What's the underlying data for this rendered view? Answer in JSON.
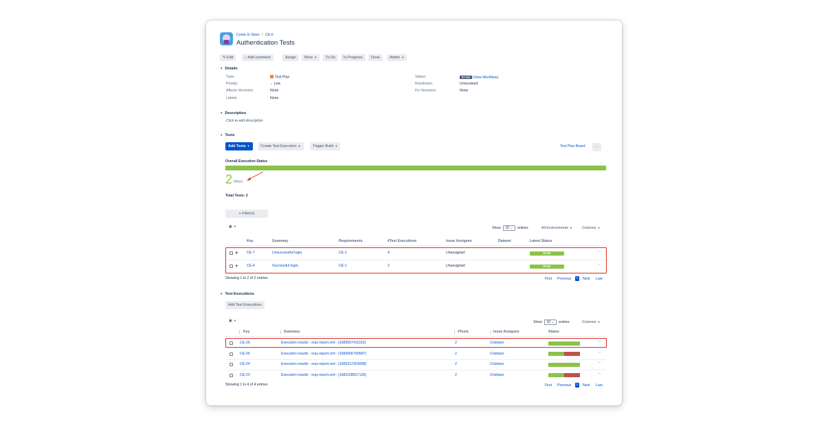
{
  "breadcrumb": {
    "project": "Comic E-Store",
    "separator": "/",
    "issue_key": "CE-6"
  },
  "issue": {
    "title": "Authentication Tests"
  },
  "toolbar": {
    "edit": "Edit",
    "add_comment": "Add comment",
    "assign": "Assign",
    "more": "More",
    "to_do": "To Do",
    "in_progress": "In Progress",
    "done": "Done",
    "admin": "Admin"
  },
  "details": {
    "heading": "Details",
    "type_label": "Type:",
    "type_value": "Test Plan",
    "priority_label": "Priority:",
    "priority_value": "Low",
    "affects_label": "Affects Version/s:",
    "affects_value": "None",
    "labels_label": "Labels:",
    "labels_value": "None",
    "status_label": "Status:",
    "status_value": "TO DO",
    "status_link": "(View Workflow)",
    "resolution_label": "Resolution:",
    "resolution_value": "Unresolved",
    "fix_label": "Fix Version/s:",
    "fix_value": "None",
    "status_badge_color": "#42526e"
  },
  "description": {
    "heading": "Description",
    "placeholder": "Click to add description"
  },
  "tests": {
    "heading": "Tests",
    "add_tests": "Add Tests",
    "create_test_execution": "Create Test Execution",
    "trigger_build": "Trigger Build",
    "test_plan_board": "Test Plan Board",
    "more_dots": "···",
    "overall_label": "Overall Execution Status",
    "overall_progress_pass_fraction": 1.0,
    "pass_count": "2",
    "pass_word": "PASS",
    "total_tests": "Total Tests: 2",
    "filter": "Filter(s)",
    "show": "Show",
    "entries_value": "10",
    "entries": "entries",
    "environments": "All Environments",
    "columns": "Columns",
    "headers": [
      "Key",
      "Summary",
      "Requirements",
      "#Test Executions",
      "Issue Assignee",
      "Dataset",
      "Latest Status"
    ],
    "rows": [
      {
        "key": "CE-7",
        "summary": "Unsuccessful login.",
        "requirement": "CE-1",
        "executions": "4",
        "assignee": "Unassigned",
        "dataset": "",
        "status": "PASS"
      },
      {
        "key": "CE-4",
        "summary": "Successful login.",
        "requirement": "CE-1",
        "executions": "2",
        "assignee": "Unassigned",
        "dataset": "",
        "status": "PASS"
      }
    ],
    "showing": "Showing 1 to 2 of 2 entries",
    "pager": {
      "first": "First",
      "previous": "Previous",
      "current": "1",
      "next": "Next",
      "last": "Last"
    },
    "pass_color": "#8bc34a"
  },
  "test_executions": {
    "heading": "Test Executions",
    "add_button": "Add Test Executions",
    "show": "Show",
    "entries_value": "10",
    "entries": "entries",
    "columns": "Columns",
    "headers": [
      "Key",
      "Summary",
      "#Tests",
      "Issue Assignee",
      "Status"
    ],
    "rows": [
      {
        "key": "CE-26",
        "summary": "Execution results - xray-report.xml - [1683567411162]",
        "tests": "2",
        "assignee": "Cristiano",
        "pass_fraction": 1.0
      },
      {
        "key": "CE-25",
        "summary": "Execution results - xray-report.xml - [1683566790587]",
        "tests": "2",
        "assignee": "Cristiano",
        "pass_fraction": 0.5
      },
      {
        "key": "CE-24",
        "summary": "Execution results - xray-report.xml - [1683212303098]",
        "tests": "2",
        "assignee": "Cristiano",
        "pass_fraction": 1.0
      },
      {
        "key": "CE-23",
        "summary": "Execution results - xray-report.xml - [1683108817126]",
        "tests": "2",
        "assignee": "Cristiano",
        "pass_fraction": 0.5
      }
    ],
    "showing": "Showing 1 to 4 of 4 entries",
    "pager": {
      "first": "First",
      "previous": "Previous",
      "current": "1",
      "next": "Next",
      "last": "Last"
    },
    "fail_color": "#c0504d"
  }
}
